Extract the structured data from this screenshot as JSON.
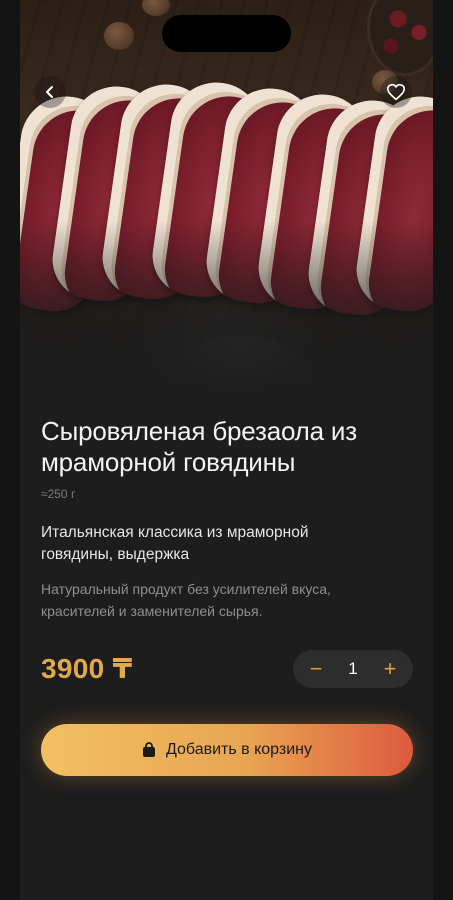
{
  "product": {
    "title": "Сыровяленая брезаола из мраморной говядины",
    "weight": "≈250 г",
    "subtitle": "Итальянская классика из мраморной говядины, выдержка",
    "description": "Натуральный продукт без усилителей вкуса, красителей и заменителей сырья.",
    "price": "3900 ₸"
  },
  "quantity": {
    "minus": "−",
    "value": "1",
    "plus": "+"
  },
  "cart_button": {
    "label": "Добавить в корзину"
  },
  "icons": {
    "back": "chevron-left-icon",
    "favorite": "heart-icon",
    "cart": "shopping-bag-icon"
  },
  "colors": {
    "accent": "#e2a94c",
    "button_start": "#f2c063",
    "button_end": "#dd5a3e",
    "background": "#1d1d1d"
  }
}
